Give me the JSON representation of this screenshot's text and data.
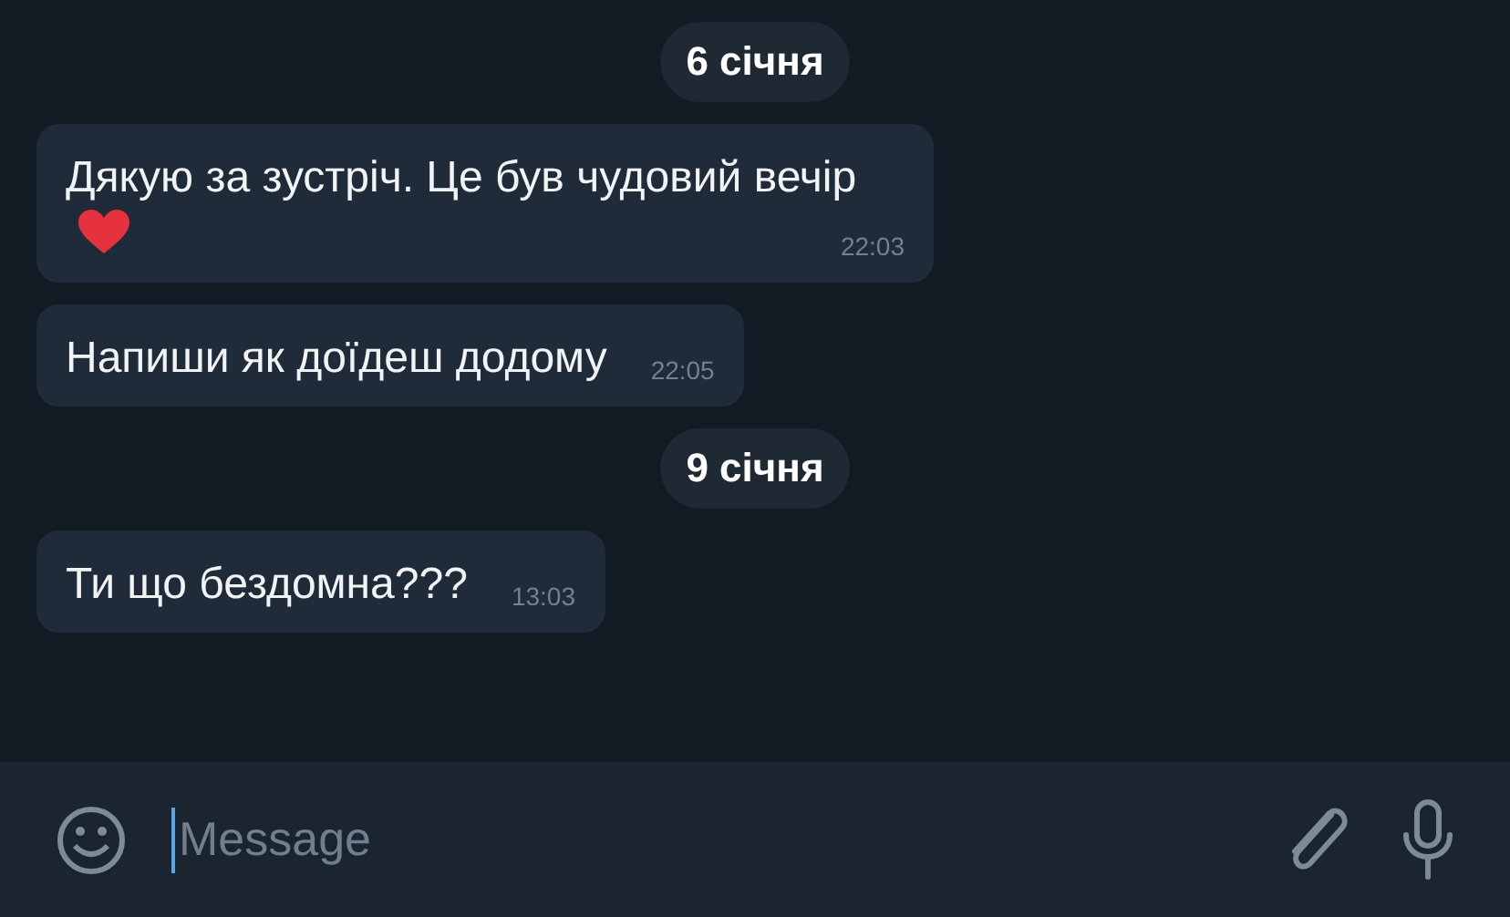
{
  "messages": [
    {
      "kind": "date",
      "text": "6 січня"
    },
    {
      "kind": "message",
      "text": "Дякую за зустріч. Це був чудовий вечір",
      "heart": true,
      "time": "22:03"
    },
    {
      "kind": "message",
      "text": "Напиши як доїдеш додому",
      "heart": false,
      "time": "22:05"
    },
    {
      "kind": "date",
      "text": "9 січня"
    },
    {
      "kind": "message",
      "text": "Ти що бездомна???",
      "heart": false,
      "time": "13:03"
    }
  ],
  "composer": {
    "placeholder": "Message"
  }
}
